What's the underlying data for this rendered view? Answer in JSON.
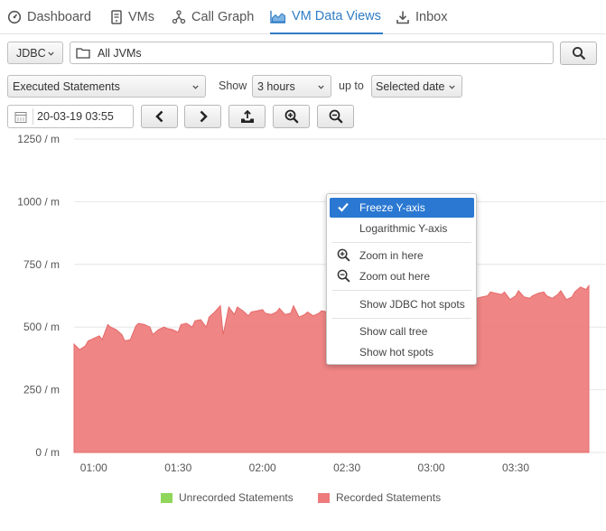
{
  "tabs": [
    {
      "label": "Dashboard",
      "icon": "speedometer-icon"
    },
    {
      "label": "VMs",
      "icon": "server-icon"
    },
    {
      "label": "Call Graph",
      "icon": "call-graph-icon"
    },
    {
      "label": "VM Data Views",
      "icon": "area-chart-icon",
      "active": true
    },
    {
      "label": "Inbox",
      "icon": "download-icon"
    }
  ],
  "toolbar": {
    "probe_select": "JDBC",
    "path": "All JVMs",
    "view_select": "Executed Statements",
    "show_label": "Show",
    "show_select": "3 hours",
    "upto_label": "up to",
    "date_select": "Selected date",
    "date_value": "20-03-19 03:55"
  },
  "context_menu": {
    "items": [
      "Freeze Y-axis",
      "Logarithmic Y-axis",
      "Zoom in here",
      "Zoom out here",
      "Show JDBC hot spots",
      "Show call tree",
      "Show hot spots"
    ],
    "checked": "Freeze Y-axis"
  },
  "colors": {
    "accent": "#2f7cc4",
    "recorded": "#ee7b7b",
    "unrecorded": "#8fd65a",
    "menu_highlight": "#2a78d2"
  },
  "chart_data": {
    "type": "area",
    "y_tick_labels": [
      "0 / m",
      "250 / m",
      "500 / m",
      "750 / m",
      "1000 / m",
      "1250 / m"
    ],
    "y_ticks": [
      0,
      250,
      500,
      750,
      1000,
      1250
    ],
    "ylim": [
      0,
      1250
    ],
    "x_tick_labels": [
      "01:00",
      "01:30",
      "02:00",
      "02:30",
      "03:00",
      "03:30"
    ],
    "x_ticks_min": [
      60,
      90,
      120,
      150,
      180,
      210
    ],
    "xlim_min": [
      53,
      236
    ],
    "grid": true,
    "legend_position": "bottom",
    "series": [
      {
        "name": "Unrecorded Statements",
        "color": "#8fd65a",
        "x_min": [
          53,
          236
        ],
        "values": [
          0,
          0
        ]
      },
      {
        "name": "Recorded Statements",
        "color": "#ee7b7b",
        "x_min": [
          53,
          55,
          57,
          58,
          60,
          62,
          63,
          65,
          66,
          68,
          70,
          71,
          73,
          75,
          76,
          78,
          80,
          81,
          83,
          85,
          86,
          88,
          90,
          91,
          93,
          95,
          96,
          98,
          100,
          101,
          103,
          105,
          106,
          108,
          110,
          111,
          113,
          115,
          116,
          118,
          120,
          121,
          123,
          125,
          126,
          128,
          130,
          131,
          133,
          135,
          136,
          138,
          140,
          141,
          143,
          145,
          146,
          148,
          150,
          151,
          153,
          155,
          156,
          158,
          160,
          161,
          163,
          165,
          166,
          168,
          170,
          171,
          173,
          175,
          176,
          178,
          180,
          181,
          183,
          185,
          186,
          188,
          190,
          191,
          193,
          195,
          196,
          198,
          200,
          201,
          203,
          205,
          206,
          208,
          210,
          211,
          213,
          215,
          216,
          218,
          220,
          221,
          223,
          225,
          226,
          228,
          230,
          231,
          233,
          235,
          236
        ],
        "values": [
          432,
          410,
          425,
          445,
          455,
          465,
          450,
          510,
          500,
          490,
          470,
          445,
          450,
          505,
          515,
          510,
          500,
          470,
          490,
          500,
          495,
          490,
          480,
          510,
          515,
          500,
          525,
          530,
          500,
          540,
          560,
          585,
          470,
          580,
          550,
          580,
          565,
          545,
          560,
          565,
          570,
          555,
          550,
          560,
          575,
          550,
          555,
          585,
          540,
          550,
          560,
          545,
          555,
          565,
          560,
          575,
          590,
          580,
          575,
          595,
          600,
          585,
          570,
          590,
          575,
          595,
          580,
          570,
          585,
          600,
          595,
          600,
          605,
          610,
          595,
          605,
          620,
          630,
          640,
          625,
          610,
          605,
          620,
          640,
          630,
          610,
          615,
          620,
          625,
          640,
          635,
          630,
          640,
          610,
          625,
          645,
          620,
          615,
          625,
          635,
          640,
          625,
          615,
          630,
          645,
          610,
          620,
          640,
          660,
          650,
          665
        ]
      }
    ]
  }
}
